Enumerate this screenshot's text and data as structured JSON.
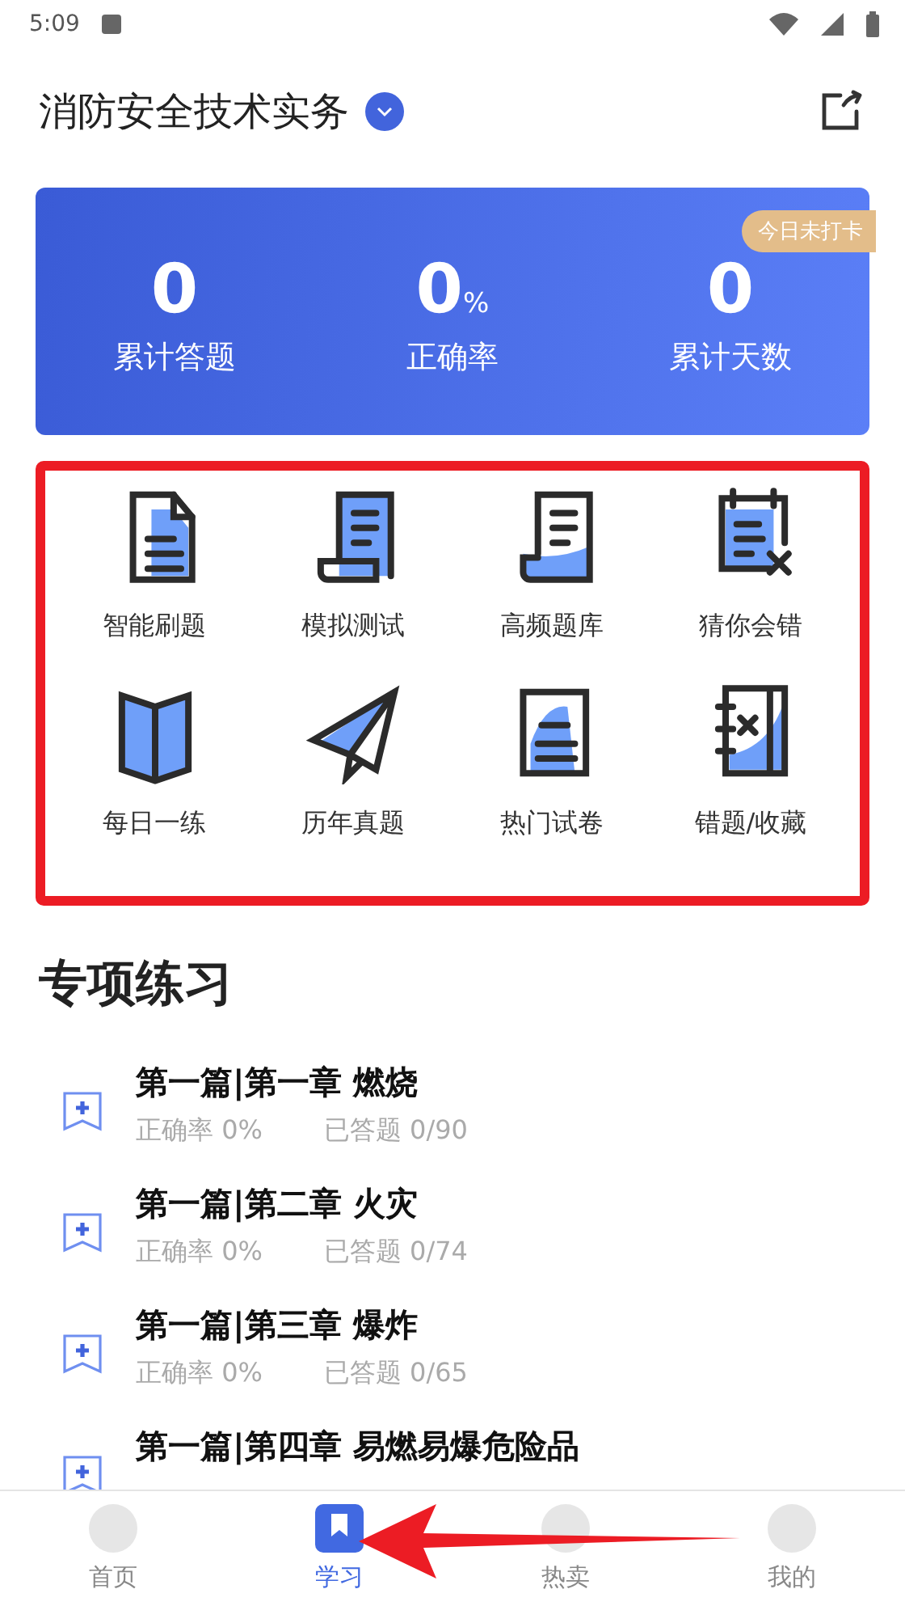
{
  "status_bar": {
    "time": "5:09"
  },
  "header": {
    "title": "消防安全技术实务"
  },
  "stats": {
    "badge": "今日未打卡",
    "items": [
      {
        "value": "0",
        "label": "累计答题"
      },
      {
        "value": "0",
        "unit": "%",
        "label": "正确率"
      },
      {
        "value": "0",
        "label": "累计天数"
      }
    ]
  },
  "features": [
    {
      "label": "智能刷题"
    },
    {
      "label": "模拟测试"
    },
    {
      "label": "高频题库"
    },
    {
      "label": "猜你会错"
    },
    {
      "label": "每日一练"
    },
    {
      "label": "历年真题"
    },
    {
      "label": "热门试卷"
    },
    {
      "label": "错题/收藏"
    }
  ],
  "section": {
    "title": "专项练习"
  },
  "topics": [
    {
      "title": "第一篇|第一章 燃烧",
      "accuracy": "正确率 0%",
      "answered": "已答题 0/90"
    },
    {
      "title": "第一篇|第二章 火灾",
      "accuracy": "正确率 0%",
      "answered": "已答题 0/74"
    },
    {
      "title": "第一篇|第三章 爆炸",
      "accuracy": "正确率 0%",
      "answered": "已答题 0/65"
    },
    {
      "title": "第一篇|第四章 易燃易爆危险品"
    }
  ],
  "tab_bar": [
    {
      "label": "首页",
      "selected": false
    },
    {
      "label": "学习",
      "selected": true
    },
    {
      "label": "热卖",
      "selected": false
    },
    {
      "label": "我的",
      "selected": false
    }
  ]
}
